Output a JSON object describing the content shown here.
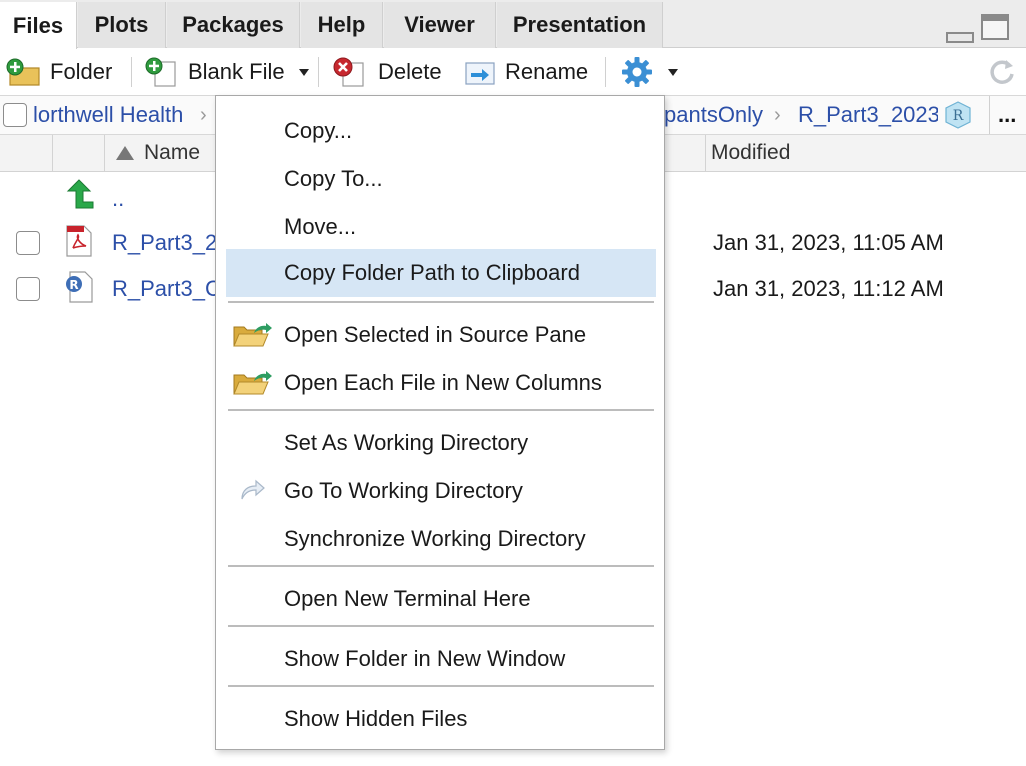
{
  "tabs": [
    {
      "label": "Files",
      "active": true
    },
    {
      "label": "Plots",
      "active": false
    },
    {
      "label": "Packages",
      "active": false
    },
    {
      "label": "Help",
      "active": false
    },
    {
      "label": "Viewer",
      "active": false
    },
    {
      "label": "Presentation",
      "active": false
    }
  ],
  "toolbar": {
    "new_folder": "Folder",
    "blank_file": "Blank File",
    "delete": "Delete",
    "rename": "Rename"
  },
  "breadcrumb": {
    "items": [
      "lorthwell Health",
      "pantsOnly",
      "R_Part3_2023"
    ],
    "more": "..."
  },
  "columns": {
    "name": "Name",
    "modified": "Modified"
  },
  "parent_dir": "..",
  "files": [
    {
      "name": "R_Part3_2023.pdf",
      "type": "pdf-icon",
      "modified": "Jan 31, 2023, 11:05 AM"
    },
    {
      "name": "R_Part3_Code.R",
      "type": "r-file-icon",
      "modified": "Jan 31, 2023, 11:12 AM"
    }
  ],
  "context_menu": {
    "copy": "Copy...",
    "copy_to": "Copy To...",
    "move": "Move...",
    "copy_path": "Copy Folder Path to Clipboard",
    "open_selected": "Open Selected in Source Pane",
    "open_each": "Open Each File in New Columns",
    "set_wd": "Set As Working Directory",
    "go_wd": "Go To Working Directory",
    "sync_wd": "Synchronize Working Directory",
    "terminal": "Open New Terminal Here",
    "show_window": "Show Folder in New Window",
    "hidden": "Show Hidden Files"
  },
  "colors": {
    "link": "#2c4fa8",
    "highlight": "#d6e6f5",
    "tabbar": "#ececec"
  }
}
